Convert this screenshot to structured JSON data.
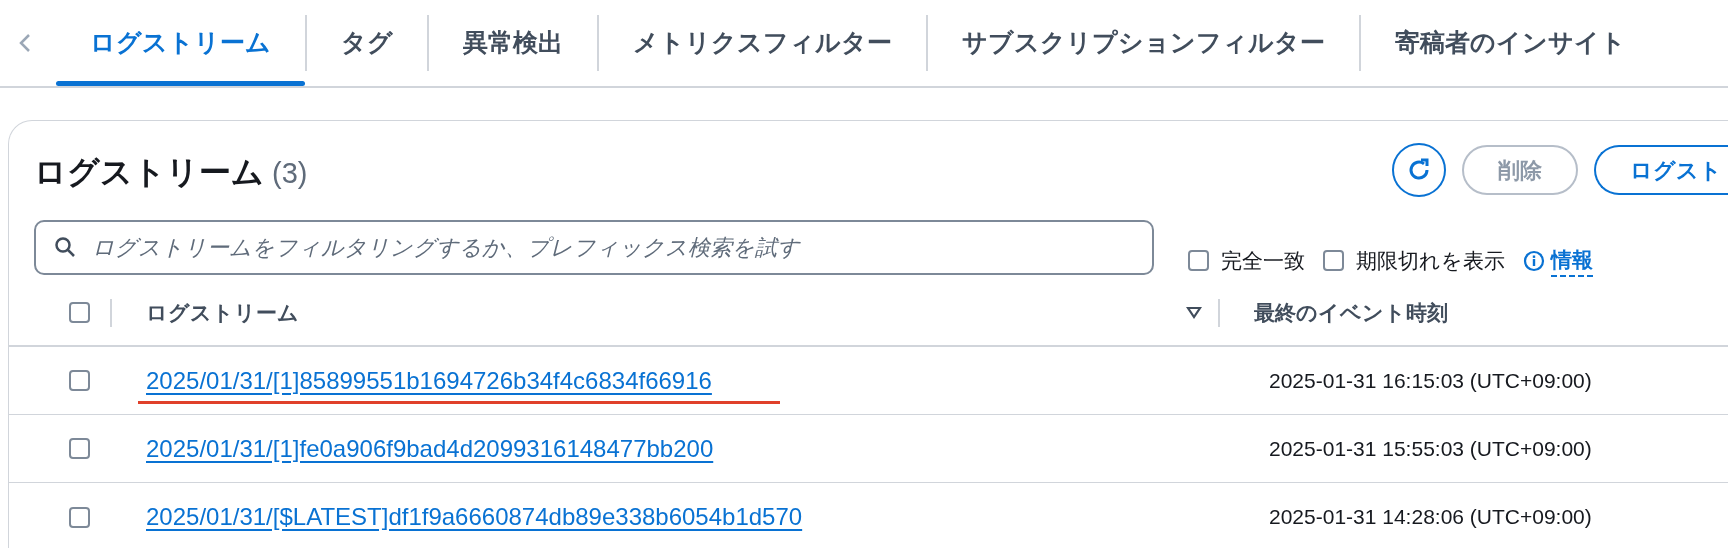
{
  "tabs": [
    {
      "label": "ログストリーム",
      "selected": true
    },
    {
      "label": "タグ",
      "selected": false
    },
    {
      "label": "異常検出",
      "selected": false
    },
    {
      "label": "メトリクスフィルター",
      "selected": false
    },
    {
      "label": "サブスクリプションフィルター",
      "selected": false
    },
    {
      "label": "寄稿者のインサイト",
      "selected": false
    }
  ],
  "panel": {
    "title": "ログストリーム",
    "count": "(3)",
    "buttons": [
      {
        "kind": "refresh"
      },
      {
        "kind": "disabled",
        "label": "削除"
      },
      {
        "kind": "primary",
        "label": "ログスト"
      }
    ],
    "search": {
      "placeholder": "ログストリームをフィルタリングするか、プレフィックス検索を試す"
    },
    "options": [
      {
        "label": "完全一致",
        "checked": false
      },
      {
        "label": "期限切れを表示",
        "checked": false
      }
    ],
    "info_link": "情報",
    "table": {
      "select_all_checked": false,
      "columns": [
        "ログストリーム",
        "最終のイベント時刻"
      ],
      "rows": [
        {
          "checked": false,
          "stream": "2025/01/31/[1]85899551b1694726b34f4c6834f66916",
          "time": "2025-01-31 16:15:03 (UTC+09:00)",
          "underlined_red": true
        },
        {
          "checked": false,
          "stream": "2025/01/31/[1]fe0a906f9bad4d2099316148477bb200",
          "time": "2025-01-31 15:55:03 (UTC+09:00)",
          "underlined_red": false
        },
        {
          "checked": false,
          "stream": "2025/01/31/[$LATEST]df1f9a6660874db89e338b6054b1d570",
          "time": "2025-01-31 14:28:06 (UTC+09:00)",
          "underlined_red": false
        }
      ]
    }
  }
}
